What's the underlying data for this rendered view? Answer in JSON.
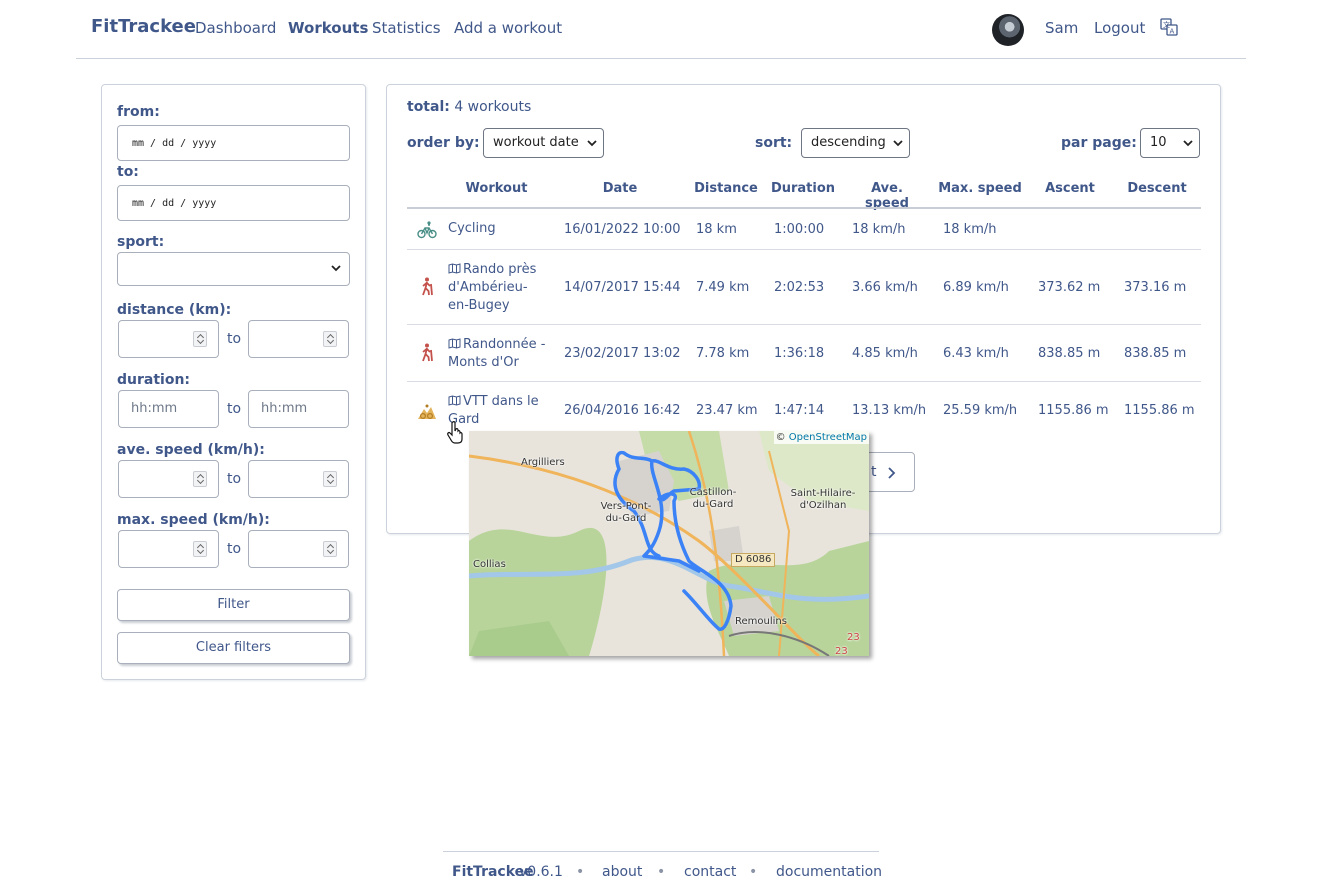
{
  "navbar": {
    "brand": "FitTrackee",
    "links": [
      "Dashboard",
      "Workouts",
      "Statistics",
      "Add a workout"
    ],
    "active": "Workouts",
    "user": "Sam",
    "logout": "Logout",
    "icons": {
      "language": "translate-icon",
      "avatar": "user-avatar"
    }
  },
  "filters": {
    "from_label": "from:",
    "from_placeholder": "mm / dd / yyyy",
    "to_label": "to:",
    "to_placeholder": "mm / dd / yyyy",
    "sport_label": "sport:",
    "sport_value": "",
    "distance_label": "distance (km):",
    "duration_label": "duration:",
    "duration_placeholder": "hh:mm",
    "ave_speed_label": "ave. speed (km/h):",
    "max_speed_label": "max. speed (km/h):",
    "to_word": "to",
    "filter_button": "Filter",
    "clear_button": "Clear filters"
  },
  "workouts": {
    "total_label": "total:",
    "total_value": "4 workouts",
    "order_by_label": "order by:",
    "order_by_value": "workout date",
    "sort_label": "sort:",
    "sort_value": "descending",
    "per_page_label": "par page:",
    "per_page_value": "10",
    "columns": [
      "Workout",
      "Date",
      "Distance",
      "Duration",
      "Ave. speed",
      "Max. speed",
      "Ascent",
      "Descent"
    ],
    "rows": [
      {
        "sport": "cycling",
        "title": "Cycling",
        "has_map": false,
        "date": "16/01/2022 10:00",
        "distance": "18 km",
        "duration": "1:00:00",
        "ave_speed": "18 km/h",
        "max_speed": "18 km/h",
        "ascent": "",
        "descent": ""
      },
      {
        "sport": "hiking",
        "title": "Rando près d'Ambérieu-en-Bugey",
        "has_map": true,
        "date": "14/07/2017 15:44",
        "distance": "7.49 km",
        "duration": "2:02:53",
        "ave_speed": "3.66 km/h",
        "max_speed": "6.89 km/h",
        "ascent": "373.62 m",
        "descent": "373.16 m"
      },
      {
        "sport": "hiking",
        "title": "Randonnée - Monts d'Or",
        "has_map": true,
        "date": "23/02/2017 13:02",
        "distance": "7.78 km",
        "duration": "1:36:18",
        "ave_speed": "4.85 km/h",
        "max_speed": "6.43 km/h",
        "ascent": "838.85 m",
        "descent": "838.85 m"
      },
      {
        "sport": "mountain-biking",
        "title": "VTT dans le Gard",
        "has_map": true,
        "date": "26/04/2016 16:42",
        "distance": "23.47 km",
        "duration": "1:47:14",
        "ave_speed": "13.13 km/h",
        "max_speed": "25.59 km/h",
        "ascent": "1155.86 m",
        "descent": "1155.86 m"
      }
    ],
    "pager_next": "t"
  },
  "map_popup": {
    "attribution_prefix": "©",
    "attribution_link": "OpenStreetMap",
    "places": [
      "Argilliers",
      "Castillon-du-Gard",
      "Saint-Hilaire-d'Ozilhan",
      "Vers-Pont-du-Gard",
      "Collias",
      "Remoulins"
    ],
    "road": "D 6086",
    "road_numbers": [
      "23",
      "23"
    ]
  },
  "footer": {
    "brand": "FitTrackee",
    "version": "v0.6.1",
    "links": [
      "about",
      "contact",
      "documentation"
    ],
    "separator": "•"
  },
  "colors": {
    "primary": "#40578a",
    "border": "#ccd2dc",
    "route": "#3b82f6"
  }
}
